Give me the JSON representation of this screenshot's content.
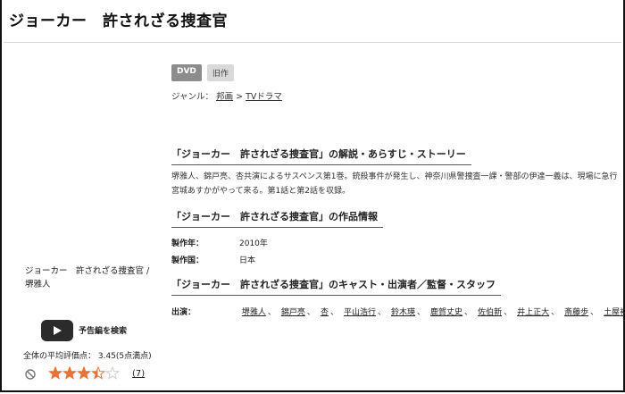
{
  "page_title": "ジョーカー　許されざる捜査官",
  "tags": [
    "DVD",
    "旧作"
  ],
  "genre": {
    "label": "ジャンル：",
    "items": [
      "邦画",
      "TVドラマ"
    ],
    "separator": ">"
  },
  "sections": {
    "synopsis_heading": "「ジョーカー　許されざる捜査官」の解説・あらすじ・ストーリー",
    "synopsis_line1": "堺雅人、錦戸亮、杏共演によるサスペンス第1巻。銃殺事件が発生し、神奈川県警捜査一課・警部の伊達一義は、現場に急行",
    "synopsis_line2": "宮城あすかがやって来る。第1話と第2話を収録。",
    "info_heading": "「ジョーカー　許されざる捜査官」の作品情報",
    "cast_heading": "「ジョーカー　許されざる捜査官」のキャスト・出演者／監督・スタッフ"
  },
  "info": {
    "year_label": "製作年：",
    "year_value": "2010年",
    "country_label": "製作国：",
    "country_value": "日本"
  },
  "cast": {
    "label": "出演：",
    "names": [
      "堺雅人",
      "錦戸亮",
      "杏",
      "平山浩行",
      "鈴木瑛",
      "鹿賀丈史",
      "佐伯新",
      "井上正大",
      "斎藤歩",
      "土屋裕一"
    ]
  },
  "sidebar": {
    "title_line1": "ジョーカー　許されざる捜査官 /",
    "title_line2": "堺雅人",
    "trailer_label": "予告編を検索",
    "avg_rating_text": "全体の平均評価点：  3.45(5点満点)",
    "rating_value": 3.45,
    "rating_max": 5,
    "review_count": "(7)"
  },
  "colors": {
    "star": "#e8703a",
    "star_empty": "#cccccc",
    "tag_dvd": "#8c8c8c",
    "tag_old": "#d9d9d9"
  }
}
